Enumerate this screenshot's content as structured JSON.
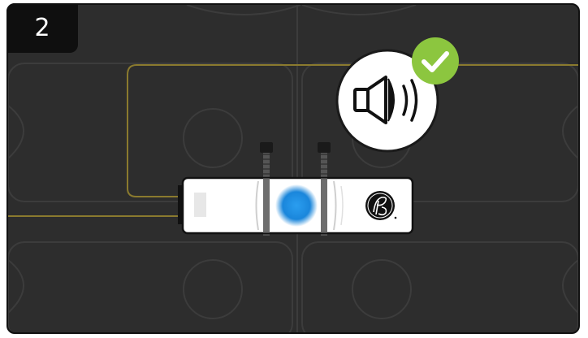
{
  "step": {
    "number": "2"
  },
  "status": {
    "sound_icon": "speaker-icon",
    "check_icon": "checkmark-icon",
    "check_color": "#8cc63f"
  },
  "device": {
    "led_color": "#1e8fe0",
    "logo_icon": "brand-logo-icon"
  },
  "colors": {
    "background": "#2d2d2d",
    "wire": "#8a7a2e",
    "surface_lines": "#3c3c3c"
  }
}
